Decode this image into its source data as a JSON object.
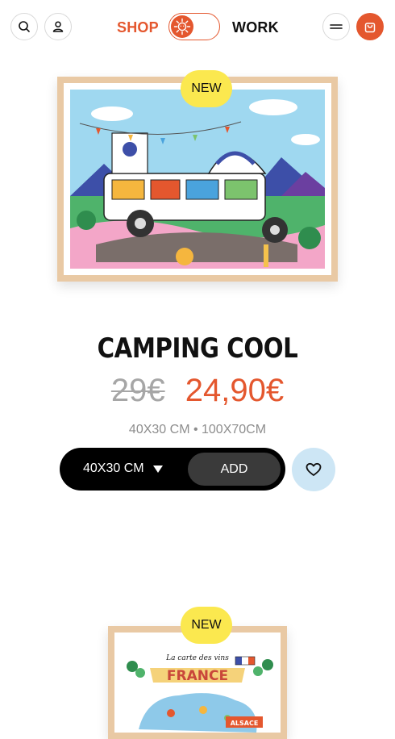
{
  "header": {
    "nav_shop": "SHOP",
    "nav_work": "WORK",
    "accent_color": "#e4572e"
  },
  "products": [
    {
      "badge": "NEW",
      "title": "CAMPING COOL",
      "old_price": "29€",
      "price": "24,90€",
      "sizes": "40X30 CM • 100X70CM",
      "selected_size": "40X30 CM",
      "add_label": "ADD"
    },
    {
      "badge": "NEW",
      "poster_script": "La carte des vins",
      "poster_title": "FRANCE",
      "poster_tag": "ALSACE"
    }
  ],
  "icons": [
    "search-icon",
    "user-icon",
    "sun-icon",
    "menu-icon",
    "cart-icon",
    "caret-down-icon",
    "heart-icon"
  ]
}
